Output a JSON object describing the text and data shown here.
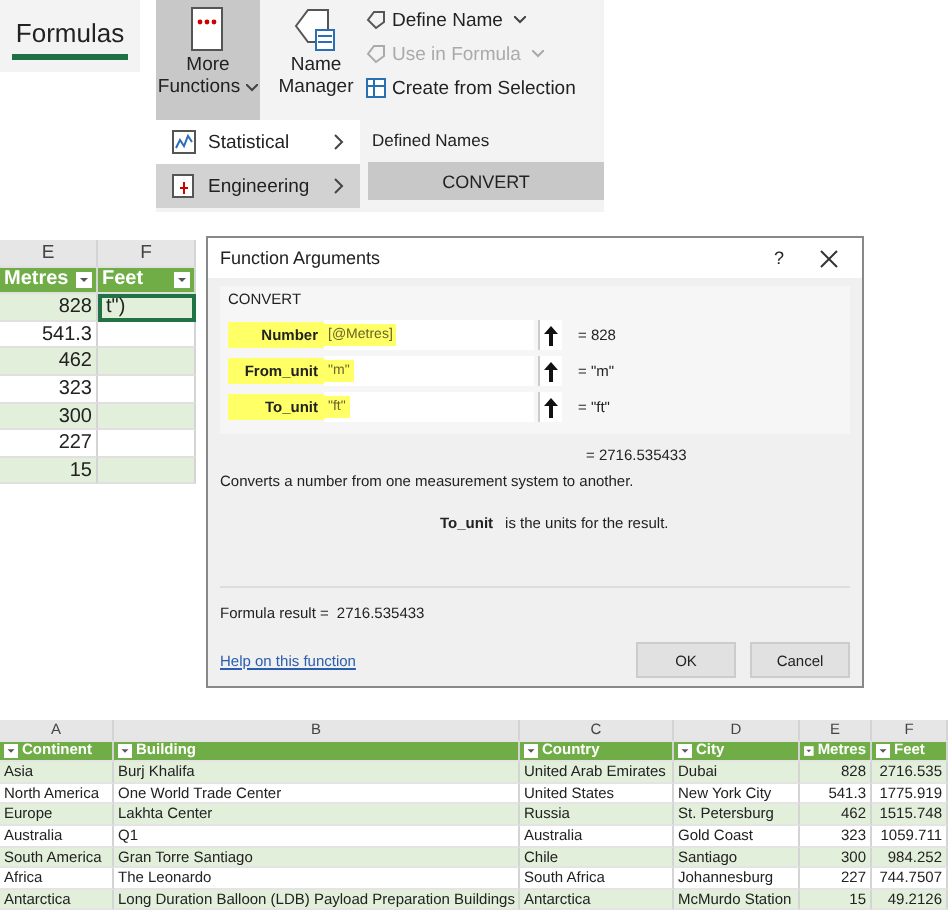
{
  "ribbon": {
    "tab": {
      "label": "Formulas",
      "selected": true
    },
    "more_functions": {
      "lines": [
        "More",
        "Functions"
      ]
    },
    "name_manager": {
      "lines": [
        "Name",
        "Manager"
      ]
    },
    "commands": [
      {
        "label": "Define Name",
        "disabled": false,
        "dropdown": true
      },
      {
        "label": "Use in Formula",
        "disabled": true,
        "dropdown": true
      },
      {
        "label": "Create from Selection",
        "disabled": false,
        "dropdown": false
      }
    ],
    "group_label": "Defined Names",
    "menu": [
      {
        "label": "Statistical",
        "kind": "chart",
        "selected": false
      },
      {
        "label": "Engineering",
        "kind": "book",
        "selected": true
      }
    ],
    "submenu": [
      {
        "label": "CONVERT"
      }
    ]
  },
  "sheet": {
    "columns": [
      "E",
      "F"
    ],
    "headers": [
      "Metres",
      "Feet"
    ],
    "rows": [
      {
        "metres": "828",
        "feet": "t\")",
        "selected": true
      },
      {
        "metres": "541.3",
        "selected": false
      },
      {
        "metres": "462",
        "selected": false
      },
      {
        "metres": "323",
        "selected": false
      },
      {
        "metres": "300",
        "selected": false
      },
      {
        "metres": "227",
        "selected": false
      },
      {
        "metres": "15",
        "selected": false
      }
    ]
  },
  "dialog": {
    "title": "Function Arguments",
    "help": "?",
    "function_name": "CONVERT",
    "arguments": [
      {
        "label": "Number",
        "value": "[@Metres]",
        "result": "= 828"
      },
      {
        "label": "From_unit",
        "value": "\"m\"",
        "result": "= \"m\""
      },
      {
        "label": "To_unit",
        "value": "\"ft\"",
        "result": "= \"ft\""
      }
    ],
    "result": "= 2716.535433",
    "description": "Converts a number from one measurement system to another.",
    "arg_help": {
      "name": "To_unit",
      "text": "is the units for the result."
    },
    "formula_result": {
      "label": "Formula result =",
      "value": "2716.535433"
    },
    "help_link": "Help on this function",
    "buttons": [
      "OK",
      "Cancel"
    ]
  },
  "table": {
    "column_letters": [
      "A",
      "B",
      "C",
      "D",
      "E",
      "F"
    ],
    "headers": [
      "Continent",
      "Building",
      "Country",
      "City",
      "Metres",
      "Feet"
    ],
    "rows": [
      [
        "Asia",
        "Burj Khalifa",
        "United Arab Emirates",
        "Dubai",
        "828",
        "2716.535"
      ],
      [
        "North America",
        "One World Trade Center",
        "United States",
        "New York City",
        "541.3",
        "1775.919"
      ],
      [
        "Europe",
        "Lakhta Center",
        "Russia",
        "St. Petersburg",
        "462",
        "1515.748"
      ],
      [
        "Australia",
        "Q1",
        "Australia",
        "Gold Coast",
        "323",
        "1059.711"
      ],
      [
        "South America",
        "Gran Torre Santiago",
        "Chile",
        "Santiago",
        "300",
        "984.252"
      ],
      [
        "Africa",
        "The Leonardo",
        "South Africa",
        "Johannesburg",
        "227",
        "744.7507"
      ],
      [
        "Antarctica",
        "Long Duration Balloon (LDB) Payload Preparation Buildings",
        "Antarctica",
        "McMurdo Station",
        "15",
        "49.2126"
      ]
    ]
  }
}
